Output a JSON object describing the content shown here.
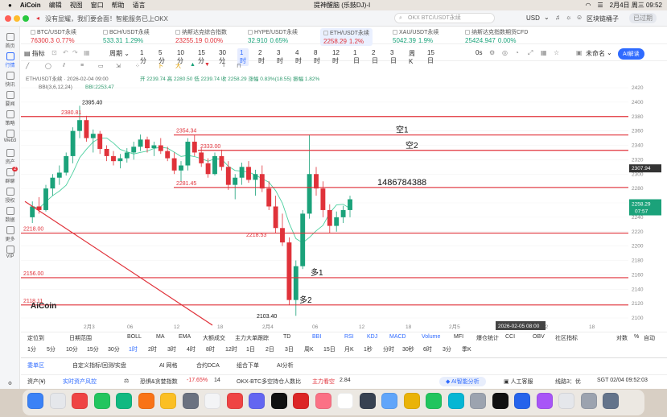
{
  "menubar": {
    "app": "AiCoin",
    "items": [
      "编辑",
      "视图",
      "窗口",
      "帮助",
      "语言"
    ],
    "notification": "没有显耀，我们要会面！智能服务已上OKX",
    "center": "提神醒脑 (乐鼓DJ)-I",
    "datetime": "2月4日 周三 09:52"
  },
  "titlebar": {
    "search_placeholder": "OKX BTC/USDT永续",
    "currency": "USD",
    "room": "区块链桶子",
    "badge": "已过期"
  },
  "sidebar": [
    {
      "label": "首页"
    },
    {
      "label": "行情"
    },
    {
      "label": "快讯"
    },
    {
      "label": "要闻"
    },
    {
      "label": "策略"
    },
    {
      "label": "Web3"
    },
    {
      "label": "资产"
    },
    {
      "label": "群聊",
      "badge": "2"
    },
    {
      "label": "授权"
    },
    {
      "label": "数据"
    },
    {
      "label": "更多"
    },
    {
      "label": "VIP"
    }
  ],
  "tickers": [
    {
      "name": "BTC/USDT永续",
      "price": "76300.3",
      "change": "0.77%",
      "color": "#e0323a"
    },
    {
      "name": "BCH/USDT永续",
      "price": "533.31",
      "change": "1.29%",
      "color": "#1ba27a"
    },
    {
      "name": "纳斯达克综合指数",
      "price": "23255.19",
      "change": "0.00%",
      "color": "#e0323a"
    },
    {
      "name": "HYPE/USDT永续",
      "price": "32.910",
      "change": "0.65%",
      "color": "#1ba27a"
    },
    {
      "name": "ETH/USDT永续",
      "price": "2258.29",
      "change": "1.2%",
      "color": "#e0323a"
    },
    {
      "name": "XAU/USDT永续",
      "price": "5042.39",
      "change": "1.9%",
      "color": "#1ba27a"
    },
    {
      "name": "纳斯达克指数期货CFD",
      "price": "25424.947",
      "change": "0.00%",
      "color": "#1ba27a"
    }
  ],
  "toolbar": {
    "indicator": "指标",
    "period": "周期",
    "timeframes": [
      "1分",
      "5分",
      "10分",
      "15分",
      "30分",
      "1时",
      "2时",
      "3时",
      "4时",
      "8时",
      "12时",
      "1日",
      "2日",
      "3日",
      "周K",
      "15日"
    ],
    "active": "1时",
    "countdown": "0s",
    "untouched": "未命名",
    "ai": "AI解读"
  },
  "chart": {
    "title": "ETH/USDT永续 · 2026-02-04 09:00",
    "ohlc": "开 2239.74 高 2280.50 低 2239.74 收 2258.29 涨幅 0.83%(18.55) 振幅 1.82%",
    "boll": "BBI(3,6,12,24)",
    "bbi": "BBI:2253.47",
    "y_ticks": [
      2420,
      2400,
      2380,
      2360,
      2340,
      2320,
      2300,
      2280,
      2260,
      2240,
      2220,
      2200,
      2180,
      2160,
      2140,
      2120,
      2100
    ],
    "x_labels": [
      "2月3",
      "06",
      "12",
      "18",
      "2月4",
      "06",
      "12",
      "18",
      "2月5",
      "12",
      "18"
    ],
    "current_price": "2258.29",
    "current_time": "07:57",
    "cursor_price": "2307.94",
    "cursor_time": "2026-02-05 08:00",
    "levels": [
      {
        "price": 2380,
        "label": "",
        "text": ""
      },
      {
        "price": 2354.34,
        "label": "2354.34",
        "text": "空1"
      },
      {
        "price": 2333.0,
        "label": "2333.00",
        "text": "空2"
      },
      {
        "price": 2281.45,
        "label": "2281.45",
        "text": "1486784388"
      },
      {
        "price": 2218.0,
        "label": "2218.00",
        "text": ""
      },
      {
        "price": 2156.0,
        "label": "2156.00",
        "text": "多1"
      },
      {
        "price": 2118.11,
        "label": "2118.11",
        "text": "多2"
      }
    ],
    "annotations": {
      "high": "2395.40",
      "high2": "2380.81",
      "low": "2103.40",
      "l2218": "2218.53"
    },
    "watermark": "AiCoin"
  },
  "indicators": {
    "left": [
      "定位到",
      "日期范围"
    ],
    "items": [
      "BOLL",
      "MA",
      "EMA",
      "大额成交",
      "主力大单跟踪",
      "TD",
      "BBI"
    ],
    "sub": [
      "RSI",
      "KDJ",
      "MACD",
      "Volume",
      "MFI",
      "爆仓统计",
      "CCI",
      "OBV",
      "社区指标"
    ],
    "right": [
      "对数",
      "%",
      "自动"
    ]
  },
  "tf2": [
    "1分",
    "5分",
    "10分",
    "15分",
    "30分",
    "1时",
    "2时",
    "3时",
    "4时",
    "8时",
    "12时",
    "1日",
    "2日",
    "3日",
    "周K",
    "15日",
    "月K",
    "1秒",
    "分时",
    "30秒",
    "6时",
    "3分",
    "季K"
  ],
  "bottom": {
    "items": [
      "委单区",
      "自定义指标/回测/实盘",
      "AI 网格",
      "合约DCA",
      "组合下单",
      "AI分析"
    ]
  },
  "status": {
    "asset": "资产(¥)",
    "risk": "实时资产风控",
    "fear": "恐惧&贪婪指数",
    "fear_val": "-17.65%",
    "fear_num": "14",
    "long_short": "OKX-BTC多空持仓人数比",
    "main": "主力看空",
    "ratio": "2.84",
    "ai": "AI智能分析",
    "service": "人工客服",
    "line": "线路3：优",
    "time": "SGT 02/04 09:52:03"
  },
  "colors": {
    "up": "#1ba27a",
    "down": "#e0323a",
    "accent": "#2f6bff"
  }
}
